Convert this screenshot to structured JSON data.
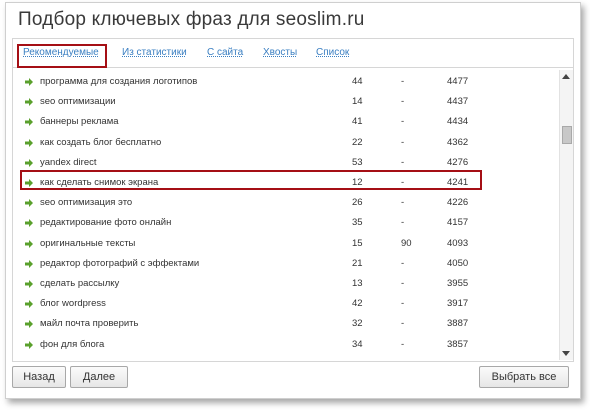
{
  "window": {
    "title": "Подбор ключевых фраз для seoslim.ru"
  },
  "tabs": [
    {
      "label": "Рекомендуемые",
      "active": true
    },
    {
      "label": "Из статистики"
    },
    {
      "label": "С сайта"
    },
    {
      "label": "Хвосты"
    },
    {
      "label": "Список"
    }
  ],
  "rows": [
    {
      "keyword": "программа для создания логотипов",
      "c1": "44",
      "c2": "-",
      "c3": "4477"
    },
    {
      "keyword": "seo оптимизации",
      "c1": "14",
      "c2": "-",
      "c3": "4437"
    },
    {
      "keyword": "баннеры реклама",
      "c1": "41",
      "c2": "-",
      "c3": "4434"
    },
    {
      "keyword": "как создать блог бесплатно",
      "c1": "22",
      "c2": "-",
      "c3": "4362",
      "highlighted": true
    },
    {
      "keyword": "yandex direct",
      "c1": "53",
      "c2": "-",
      "c3": "4276"
    },
    {
      "keyword": "как сделать снимок экрана",
      "c1": "12",
      "c2": "-",
      "c3": "4241"
    },
    {
      "keyword": "seo оптимизация это",
      "c1": "26",
      "c2": "-",
      "c3": "4226"
    },
    {
      "keyword": "редактирование фото онлайн",
      "c1": "35",
      "c2": "-",
      "c3": "4157"
    },
    {
      "keyword": "оригинальные тексты",
      "c1": "15",
      "c2": "90",
      "c3": "4093"
    },
    {
      "keyword": "редактор фотографий с эффектами",
      "c1": "21",
      "c2": "-",
      "c3": "4050"
    },
    {
      "keyword": "сделать рассылку",
      "c1": "13",
      "c2": "-",
      "c3": "3955"
    },
    {
      "keyword": "блог wordpress",
      "c1": "42",
      "c2": "-",
      "c3": "3917"
    },
    {
      "keyword": "майл почта проверить",
      "c1": "32",
      "c2": "-",
      "c3": "3887"
    },
    {
      "keyword": "фон для блога",
      "c1": "34",
      "c2": "-",
      "c3": "3857"
    }
  ],
  "buttons": {
    "back": "Назад",
    "next": "Далее",
    "select_all": "Выбрать все"
  },
  "colors": {
    "accent_link": "#3a7fc2",
    "highlight_border": "#a50f15",
    "row_arrow": "#5aa02c"
  },
  "icons": {
    "row": "green-arrow-right-icon",
    "scroll_up": "scroll-up-arrow-icon",
    "scroll_down": "scroll-down-arrow-icon"
  }
}
